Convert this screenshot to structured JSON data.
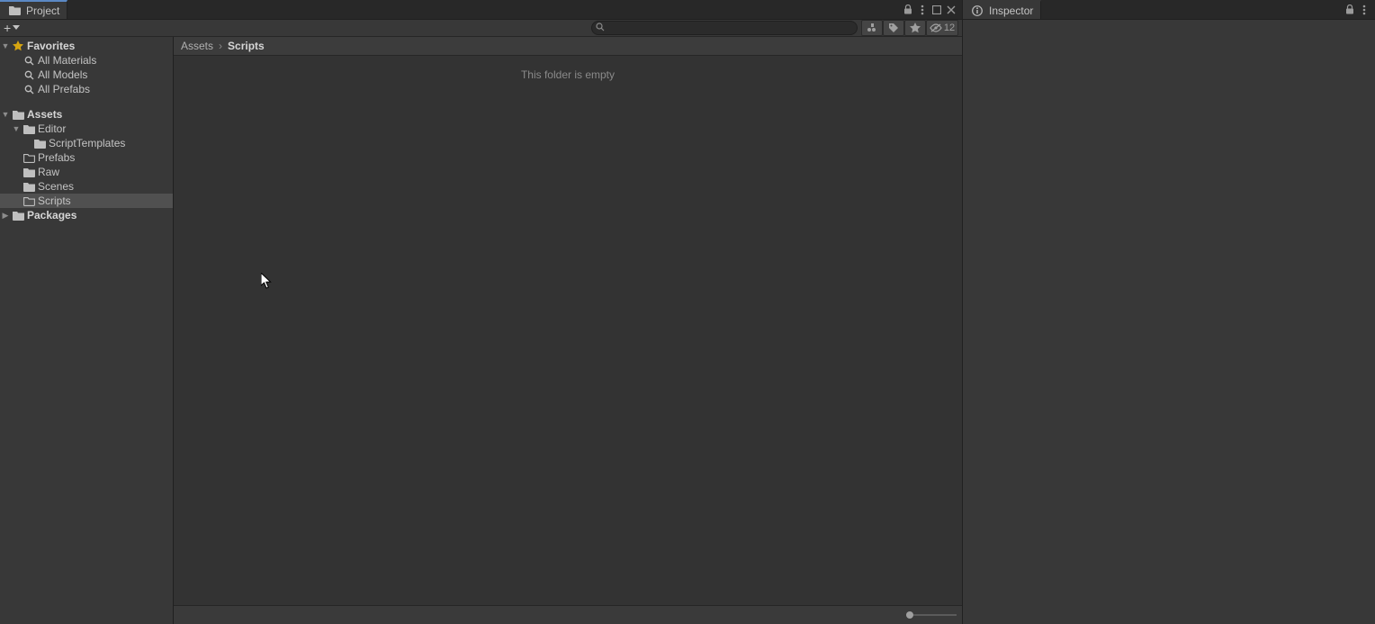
{
  "tabs": {
    "project": "Project",
    "inspector": "Inspector"
  },
  "sidebar": {
    "favorites": {
      "label": "Favorites",
      "items": [
        "All Materials",
        "All Models",
        "All Prefabs"
      ]
    },
    "assets": {
      "label": "Assets",
      "editor": "Editor",
      "scriptTemplates": "ScriptTemplates",
      "prefabs": "Prefabs",
      "raw": "Raw",
      "scenes": "Scenes",
      "scripts": "Scripts"
    },
    "packages": {
      "label": "Packages"
    }
  },
  "toolbar": {
    "hiddenCount": "12"
  },
  "breadcrumbs": {
    "root": "Assets",
    "current": "Scripts"
  },
  "content": {
    "emptyMessage": "This folder is empty"
  },
  "search": {
    "placeholder": ""
  }
}
